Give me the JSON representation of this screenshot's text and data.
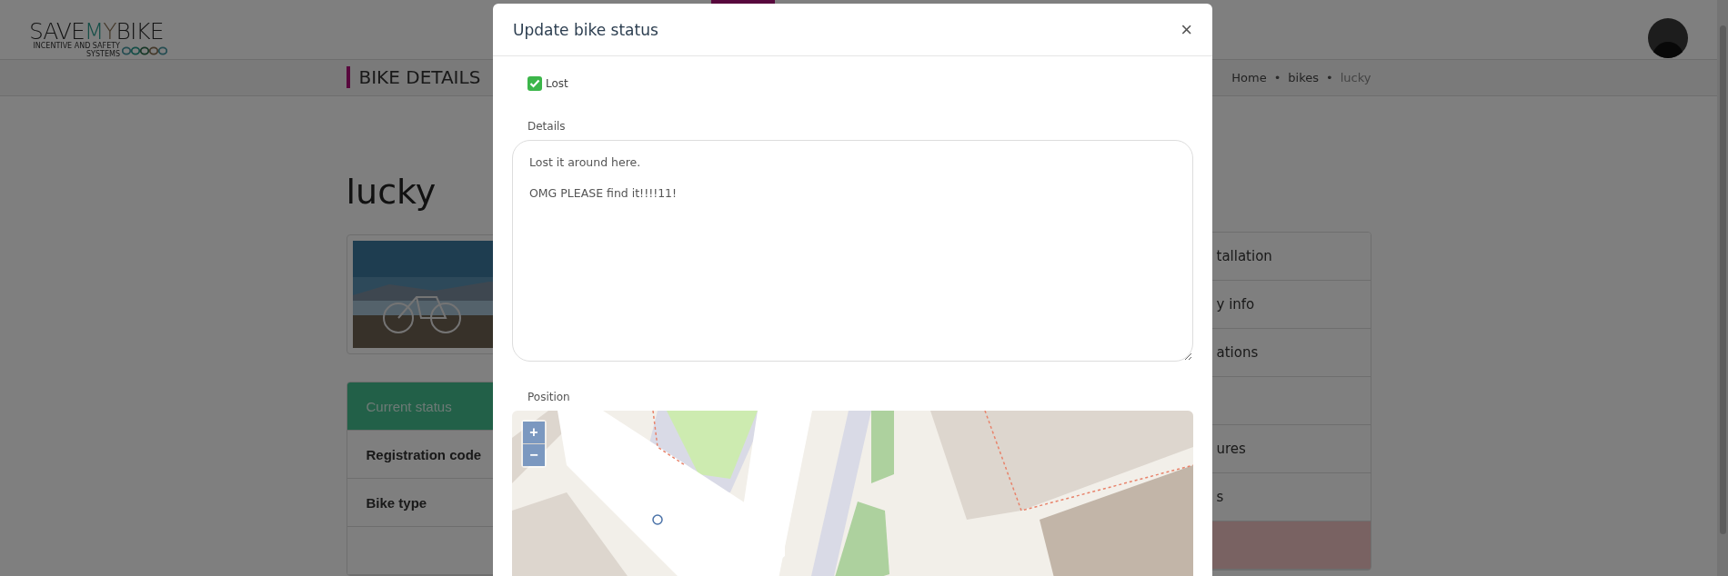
{
  "header": {
    "logo": {
      "parts": [
        {
          "text": "SAVE",
          "kind": "plain"
        },
        {
          "text": "M",
          "kind": "accent"
        },
        {
          "text": "Y",
          "kind": "secondary"
        },
        {
          "text": "BIKE",
          "kind": "plain"
        }
      ],
      "tagline": "INCENTIVE AND SAFETY SYSTEMS"
    }
  },
  "page_header": {
    "title": "BIKE DETAILS",
    "breadcrumb": [
      {
        "kind": "link",
        "label": "Home"
      },
      {
        "kind": "separator",
        "label": "•"
      },
      {
        "kind": "link",
        "label": "bikes"
      },
      {
        "kind": "separator",
        "label": "•"
      },
      {
        "kind": "current",
        "label": "lucky"
      }
    ]
  },
  "bike": {
    "name": "lucky"
  },
  "left_menu": [
    {
      "label": "Current status",
      "selected": true
    },
    {
      "label": "Registration code",
      "selected": false
    },
    {
      "label": "Bike type",
      "selected": false
    },
    {
      "selected": false
    }
  ],
  "right_menu": [
    {
      "label": "tallation",
      "highlighted": false
    },
    {
      "label": "y info",
      "highlighted": false
    },
    {
      "label": "ations",
      "highlighted": false
    },
    {
      "highlighted": false
    },
    {
      "label": "ures",
      "highlighted": false
    },
    {
      "label": "s",
      "highlighted": false
    },
    {
      "highlighted": true
    }
  ],
  "modal": {
    "title": "Update bike status",
    "close": "×",
    "lost": {
      "label": "Lost",
      "checked": true
    },
    "details": {
      "label": "Details",
      "value": "Lost it around here.\n\nOMG PLEASE find it!!!!11!"
    },
    "position": {
      "label": "Position",
      "map": {
        "kind": "picture",
        "zoom_in": "+",
        "zoom_out": "−"
      }
    }
  }
}
